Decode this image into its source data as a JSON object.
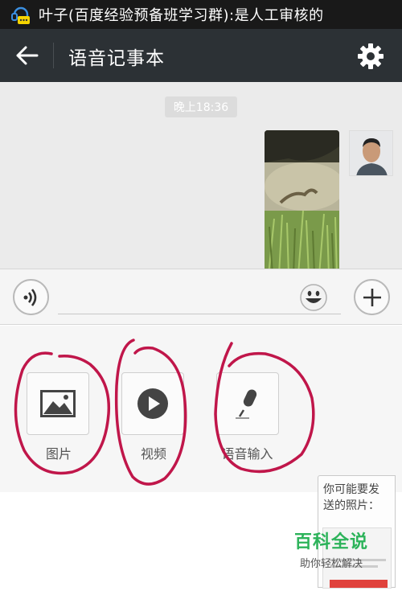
{
  "status_bar": {
    "notification_text": "叶子(百度经验预备班学习群):是人工审核的",
    "icon": "chat-notification-icon"
  },
  "header": {
    "back_icon": "back-arrow-icon",
    "title": "语音记事本",
    "settings_icon": "gear-icon"
  },
  "chat": {
    "timestamp": "晚上18:36",
    "messages": [
      {
        "type": "video",
        "thumbnail": "lizard-on-grass",
        "sender": "self"
      }
    ]
  },
  "input_bar": {
    "voice_icon": "voice-wave-icon",
    "text_value": "",
    "emoji_icon": "smiley-icon",
    "plus_icon": "plus-icon"
  },
  "tools": [
    {
      "label": "图片",
      "icon": "image-icon"
    },
    {
      "label": "视频",
      "icon": "play-icon"
    },
    {
      "label": "语音输入",
      "icon": "microphone-icon"
    }
  ],
  "suggestion_popup": {
    "text": "你可能要发送的照片："
  },
  "watermark": {
    "title": "百科全说",
    "subtitle": "助你轻松解决"
  },
  "colors": {
    "titlebar": "#2c3135",
    "chat_bg": "#ebebeb",
    "annotation": "#c0164a",
    "watermark_green": "#2cb35a"
  }
}
